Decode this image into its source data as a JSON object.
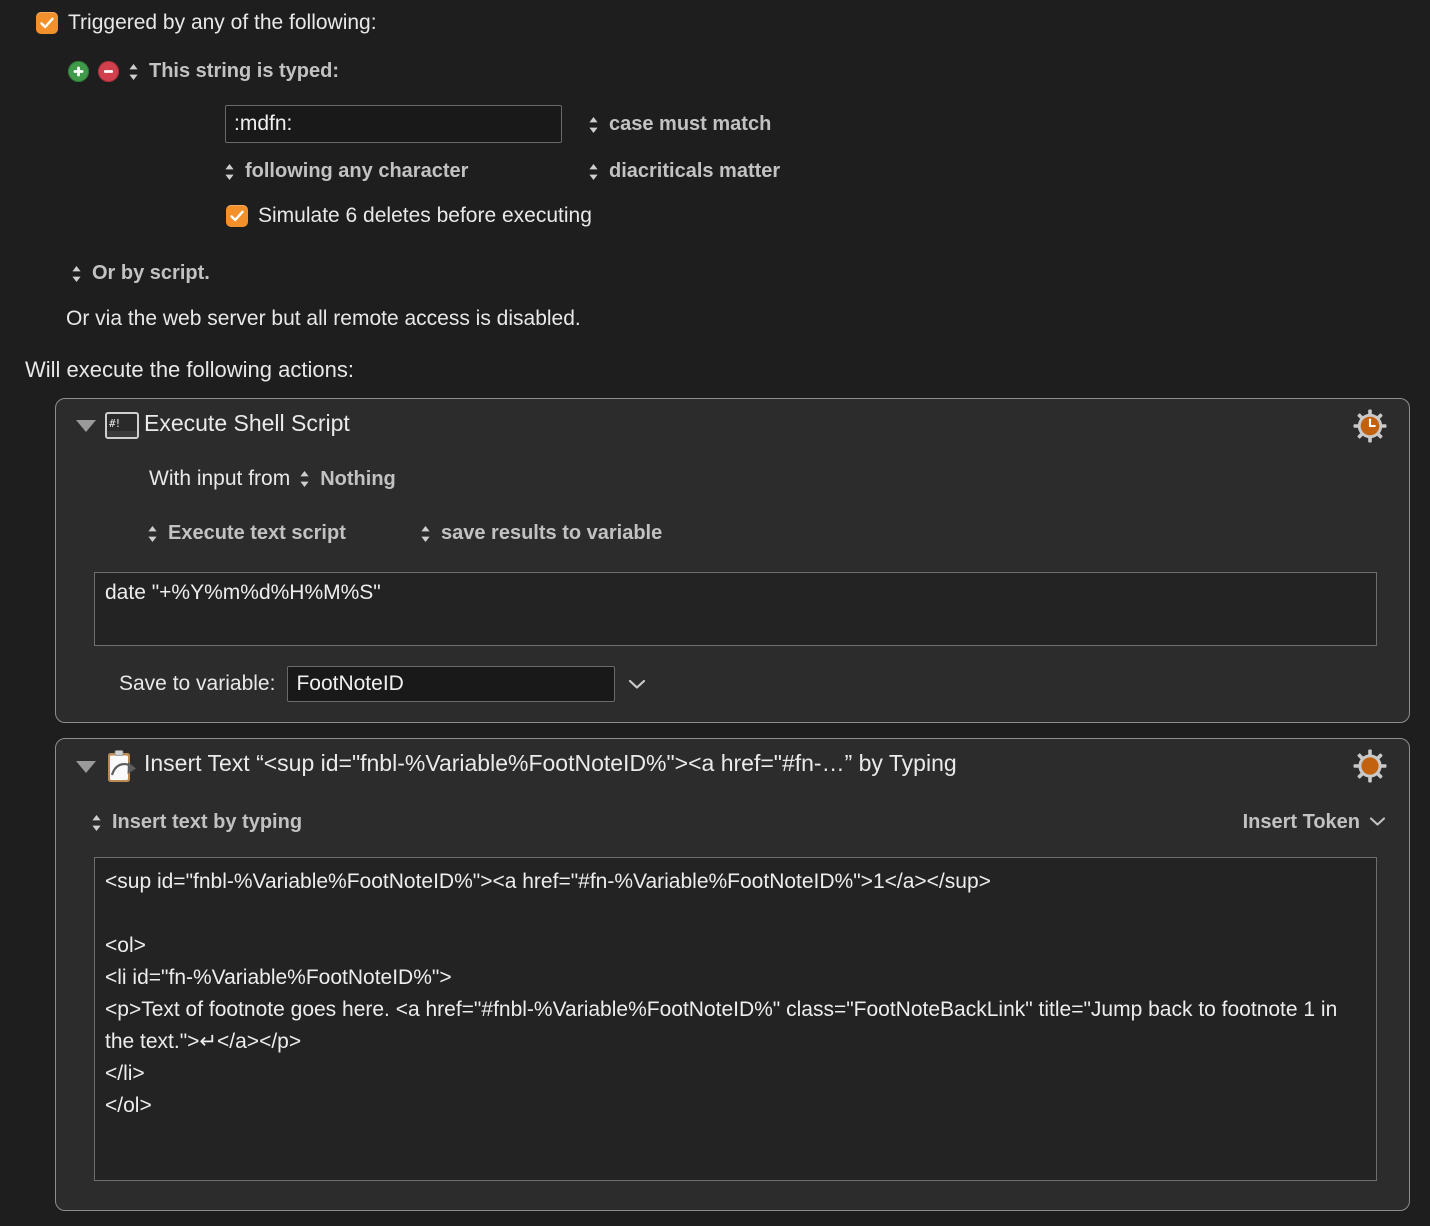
{
  "trigger": {
    "header_label": "Triggered by any of the following:",
    "header_checked": true,
    "add_button": "+",
    "remove_button": "−",
    "type_label": "This string is typed:",
    "string_value": ":mdfn:",
    "string_placeholder": "",
    "case_option": "case must match",
    "following_option": "following any character",
    "diacriticals_option": "diacriticals matter",
    "simulate_label": "Simulate 6 deletes before executing",
    "simulate_checked": true,
    "or_by_script": "Or by script.",
    "web_server_note": "Or via the web server but all remote access is disabled."
  },
  "actions_header": "Will execute the following actions:",
  "actions": [
    {
      "title": "Execute Shell Script",
      "icon": "shell-script-icon",
      "gear_icon": "gear-clock-icon",
      "disclosure": "expanded",
      "with_input_label": "With input from",
      "with_input_value": "Nothing",
      "execute_mode": "Execute text script",
      "results_mode": "save results to variable",
      "script": "date \"+%Y%m%d%H%M%S\"",
      "save_to_variable_label": "Save to variable:",
      "save_to_variable_value": "FootNoteID",
      "save_to_variable_placeholder": ""
    },
    {
      "title": "Insert Text “<sup id=\"fnbl-%Variable%FootNoteID%\"><a href=\"#fn-…” by Typing",
      "icon": "clipboard-paste-icon",
      "gear_icon": "gear-icon",
      "disclosure": "expanded",
      "insert_mode": "Insert text by typing",
      "insert_token_label": "Insert Token",
      "text": "<sup id=\"fnbl-%Variable%FootNoteID%\"><a href=\"#fn-%Variable%FootNoteID%\">1</a></sup>\n\n<ol>\n<li id=\"fn-%Variable%FootNoteID%\">\n<p>Text of footnote goes here. <a href=\"#fnbl-%Variable%FootNoteID%\" class=\"FootNoteBackLink\" title=\"Jump back to footnote 1 in the text.\">↵</a></p>\n</li>\n</ol>"
    }
  ],
  "colors": {
    "page_background": "#1e1e1e",
    "panel_background": "#2c2c2c",
    "panel_border": "#8e8e8e",
    "field_background": "#191919",
    "checkbox_accent": "#f2902c",
    "add_button": "#3f9b4a",
    "remove_button": "#d0414d",
    "gear_accent": "#c2620f",
    "popup_label": "#c2c2c2",
    "text": "#e8e8e8"
  }
}
